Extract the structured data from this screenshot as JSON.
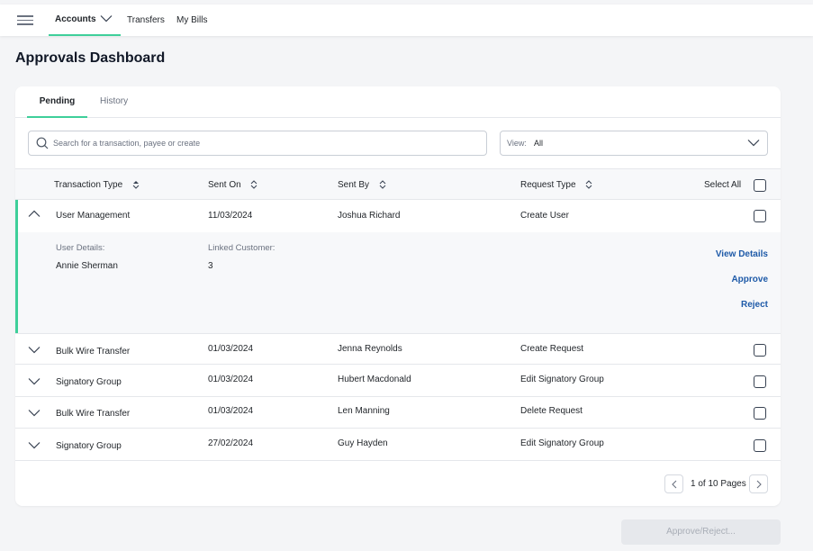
{
  "nav": {
    "items": [
      {
        "label": "Accounts"
      },
      {
        "label": "Transfers"
      },
      {
        "label": "My Bills"
      }
    ]
  },
  "page": {
    "title": "Approvals Dashboard"
  },
  "tabs": [
    {
      "label": "Pending",
      "active": true
    },
    {
      "label": "History",
      "active": false
    }
  ],
  "search": {
    "placeholder": "Search for a transaction, payee or create",
    "value": ""
  },
  "view_filter": {
    "label": "View:",
    "value": "All"
  },
  "table": {
    "columns": [
      "Transaction Type",
      "Sent On",
      "Sent By",
      "Request Type"
    ],
    "select_all_label": "Select All",
    "rows": [
      {
        "type": "User Management",
        "sent_on": "11/03/2024",
        "sent_by": "Joshua Richard",
        "request_type": "Create User",
        "expanded": true
      },
      {
        "type": "Bulk Wire Transfer",
        "sent_on": "01/03/2024",
        "sent_by": "Jenna Reynolds",
        "request_type": "Create Request",
        "expanded": false
      },
      {
        "type": "Signatory Group",
        "sent_on": "01/03/2024",
        "sent_by": "Hubert Macdonald",
        "request_type": "Edit Signatory Group",
        "expanded": false
      },
      {
        "type": "Bulk Wire Transfer",
        "sent_on": "01/03/2024",
        "sent_by": "Len Manning",
        "request_type": "Delete Request",
        "expanded": false
      },
      {
        "type": "Signatory Group",
        "sent_on": "27/02/2024",
        "sent_by": "Guy Hayden",
        "request_type": "Edit Signatory Group",
        "expanded": false
      }
    ]
  },
  "detail": {
    "user_details_label": "User Details:",
    "user_details_value": "Annie Sherman",
    "linked_customer_label": "Linked Customer:",
    "linked_customer_value": "3",
    "actions": {
      "view": "View Details",
      "approve": "Approve",
      "reject": "Reject"
    }
  },
  "pagination": {
    "text": "1 of 10 Pages"
  },
  "footer": {
    "approve_reject_label": "Approve/Reject..."
  },
  "colors": {
    "accent": "#3ecf9a",
    "link": "#1e5aa8",
    "disabled": "#e6e8ec"
  },
  "icons": [
    "menu-icon",
    "chevron-down-icon",
    "search-icon",
    "sort-icon",
    "chevron-up-icon",
    "chevron-left-icon",
    "chevron-right-icon"
  ]
}
